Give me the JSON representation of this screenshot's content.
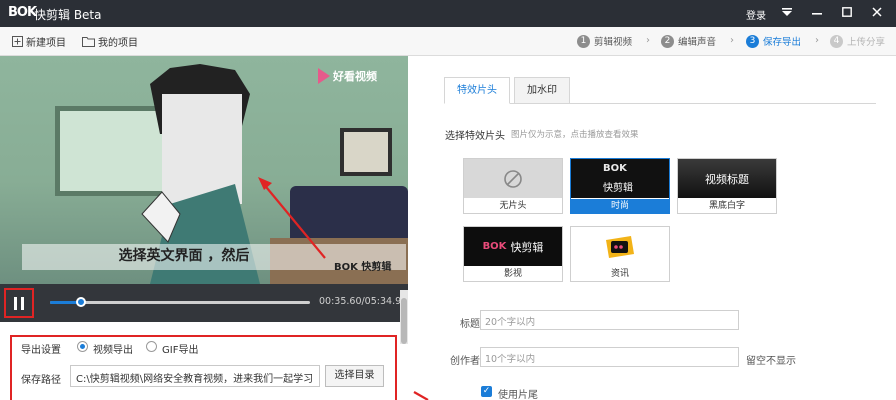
{
  "app": {
    "logo_text": "BOK",
    "title": "快剪辑 Beta",
    "login": "登录"
  },
  "toolbar": {
    "new_project": "新建项目",
    "my_projects": "我的项目",
    "steps": [
      {
        "num": "1",
        "label": "剪辑视频"
      },
      {
        "num": "2",
        "label": "编辑声音"
      },
      {
        "num": "3",
        "label": "保存导出"
      },
      {
        "num": "4",
        "label": "上传分享"
      }
    ]
  },
  "preview": {
    "video_logo": "好看视频",
    "subtitle": "选择英文界面 ，然后",
    "watermark": "BOK 快剪辑",
    "time": "00:35.60/05:34.96",
    "progress": 0.12
  },
  "export": {
    "settings_label": "导出设置",
    "video_export": "视频导出",
    "gif_export": "GIF导出",
    "path_label": "保存路径",
    "path_value": "C:\\快剪辑视频\\网络安全教育视频，进来我们一起学习",
    "choose_dir": "选择目录"
  },
  "right": {
    "tabs": [
      "特效片头",
      "加水印"
    ],
    "section_title": "选择特效片头",
    "section_hint": "图片仅为示意，点击播放查看效果",
    "cards": [
      {
        "label": "无片头"
      },
      {
        "label": "时尚",
        "thumb_text": "快剪辑",
        "thumb_logo": "BOK"
      },
      {
        "label": "黑底白字",
        "thumb_text": "视频标题"
      },
      {
        "label": "影视",
        "thumb_text": "快剪辑",
        "thumb_logo": "BOK"
      },
      {
        "label": "资讯"
      }
    ],
    "title_label": "标题",
    "title_placeholder": "20个字以内",
    "author_label": "创作者",
    "author_placeholder": "10个字以内",
    "author_hint": "留空不显示",
    "use_ending": "使用片尾"
  },
  "colors": {
    "accent": "#1b7dd8",
    "highlight_red": "#e02424",
    "titlebar": "#2b2f36"
  }
}
